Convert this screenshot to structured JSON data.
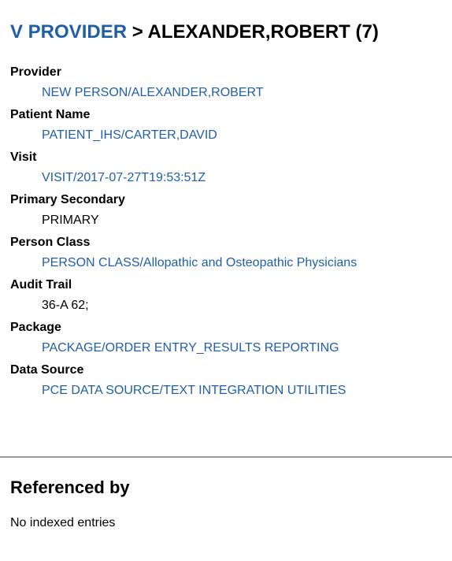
{
  "header": {
    "breadcrumb": "V PROVIDER",
    "separator": ">",
    "record_name": "ALEXANDER,ROBERT (7)"
  },
  "fields": [
    {
      "label": "Provider",
      "value": "NEW PERSON/ALEXANDER,ROBERT",
      "is_link": true
    },
    {
      "label": "Patient Name",
      "value": "PATIENT_IHS/CARTER,DAVID",
      "is_link": true
    },
    {
      "label": "Visit",
      "value": "VISIT/2017-07-27T19:53:51Z",
      "is_link": true
    },
    {
      "label": "Primary Secondary",
      "value": "PRIMARY",
      "is_link": false
    },
    {
      "label": "Person Class",
      "value": "PERSON CLASS/Allopathic and Osteopathic Physicians",
      "is_link": true
    },
    {
      "label": "Audit Trail",
      "value": "36-A 62;",
      "is_link": false
    },
    {
      "label": "Package",
      "value": "PACKAGE/ORDER ENTRY_RESULTS REPORTING",
      "is_link": true
    },
    {
      "label": "Data Source",
      "value": "PCE DATA SOURCE/TEXT INTEGRATION UTILITIES",
      "is_link": true
    }
  ],
  "referenced_by": {
    "title": "Referenced by",
    "empty_text": "No indexed entries"
  },
  "colors": {
    "link": "#1f5fa8",
    "divider": "#9a9a9a"
  }
}
